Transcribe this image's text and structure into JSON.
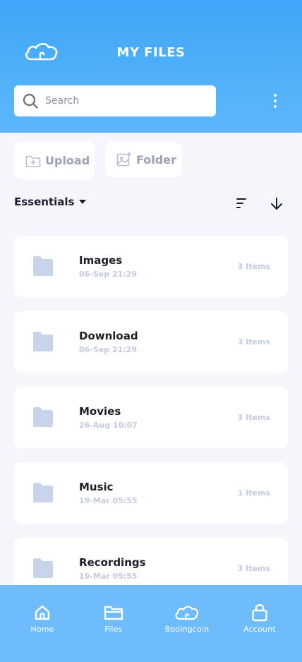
{
  "header": {
    "title": "MY FILES",
    "search": {
      "placeholder": "Search",
      "value": ""
    }
  },
  "actions": {
    "upload_label": "Upload",
    "folder_label": "Folder"
  },
  "section": {
    "title": "Essentials"
  },
  "folders": [
    {
      "name": "Images",
      "date": "06-Sep 21:29",
      "count": "3 Items"
    },
    {
      "name": "Download",
      "date": "06-Sep 21:29",
      "count": "3 Items"
    },
    {
      "name": "Movies",
      "date": "26-Aug 10:07",
      "count": "3 Items"
    },
    {
      "name": "Music",
      "date": "19-Mar 05:55",
      "count": "1 Items"
    },
    {
      "name": "Recordings",
      "date": "19-Mar 05:55",
      "count": "3 Items"
    }
  ],
  "nav": [
    {
      "label": "Home",
      "icon": "home-icon"
    },
    {
      "label": "Files",
      "icon": "folder-icon"
    },
    {
      "label": "Booingcoin",
      "icon": "cloud-icon"
    },
    {
      "label": "Account",
      "icon": "lock-icon"
    }
  ],
  "colors": {
    "header_top": "#3ea6f8",
    "header_bottom": "#5db8fa",
    "bottom_nav": "#6ebcfb",
    "folder_icon": "#c8d4ea",
    "muted_text": "#c3cbe0"
  }
}
